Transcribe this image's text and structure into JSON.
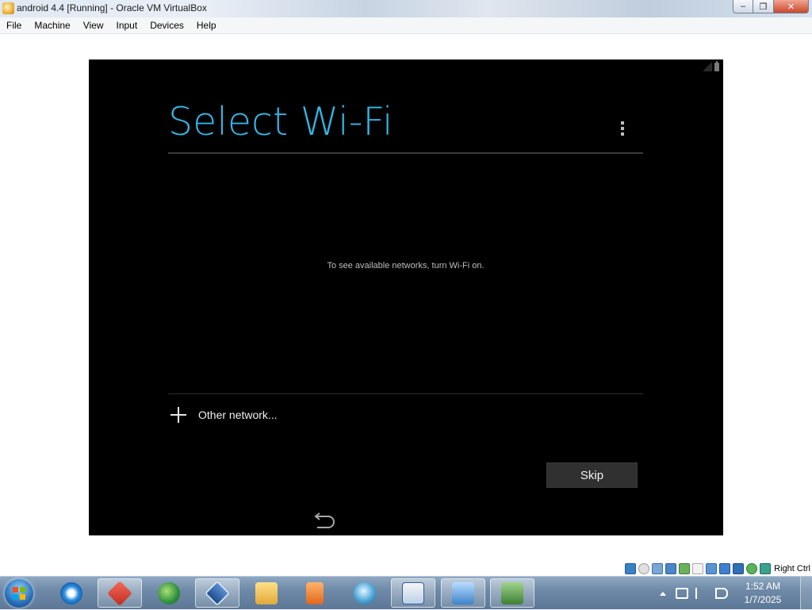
{
  "window": {
    "title": "android 4.4 [Running] - Oracle VM VirtualBox",
    "controls": {
      "minimize": "–",
      "restore": "❐",
      "close": "✕"
    }
  },
  "menubar": {
    "items": [
      "File",
      "Machine",
      "View",
      "Input",
      "Devices",
      "Help"
    ]
  },
  "android": {
    "title": "Select Wi-Fi",
    "empty_message": "To see available networks, turn Wi-Fi on.",
    "other_network_label": "Other network...",
    "skip_label": "Skip",
    "accent_color": "#33b5e5"
  },
  "vbox_status": {
    "indicators": [
      "hard-disk-icon",
      "optical-drive-icon",
      "audio-icon",
      "network-icon",
      "usb-icon",
      "shared-folders-icon",
      "display-icon",
      "video-capture-icon",
      "cpu-virtualization-icon",
      "mouse-integration-icon",
      "keyboard-icon"
    ],
    "host_key": "Right Ctrl"
  },
  "taskbar": {
    "pinned": [
      "internet-explorer-icon",
      "app-red-icon",
      "download-manager-icon",
      "virtualbox-icon",
      "explorer-folder-icon",
      "media-player-icon",
      "globe-app-icon",
      "windows7-64-icon",
      "remote-desktop-icon",
      "virtual-machine-icon"
    ],
    "clock": {
      "time": "1:52 AM",
      "date": "1/7/2025"
    }
  }
}
